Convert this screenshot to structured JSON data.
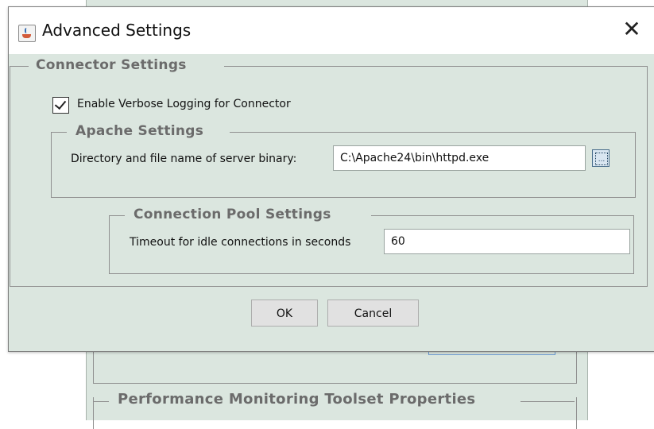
{
  "background": {
    "panel_title": "Performance Monitoring Toolset Properties"
  },
  "dialog": {
    "title": "Advanced Settings",
    "close_glyph": "✕",
    "connector": {
      "title": "Connector Settings",
      "verbose_label": "Enable Verbose Logging for Connector",
      "verbose_checked": true
    },
    "apache": {
      "title": "Apache Settings",
      "binary_label": "Directory and file name of server binary:",
      "binary_value": "C:\\Apache24\\bin\\httpd.exe",
      "browse_glyph": "..."
    },
    "pool": {
      "title": "Connection Pool Settings",
      "timeout_label": "Timeout for idle connections in seconds",
      "timeout_value": "60"
    },
    "buttons": {
      "ok": "OK",
      "cancel": "Cancel"
    }
  },
  "colors": {
    "dialog_bg": "#dbe6df",
    "group_title": "#6b6b6b"
  }
}
